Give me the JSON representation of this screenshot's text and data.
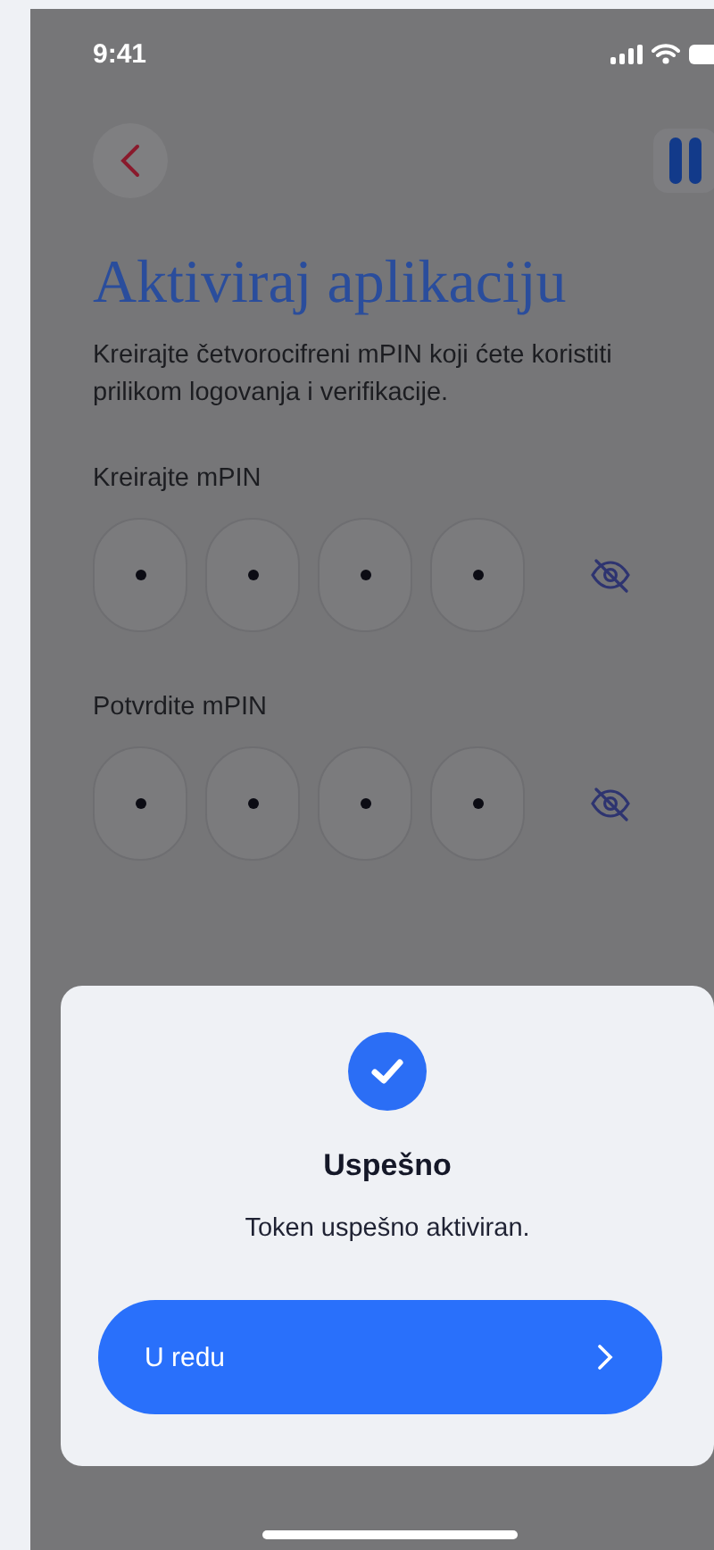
{
  "status_bar": {
    "time": "9:41"
  },
  "title": "Aktiviraj aplikaciju",
  "description": "Kreirajte četvorocifreni mPIN koji ćete koristiti prilikom logovanja i verifikacije.",
  "pin_groups": [
    {
      "label": "Kreirajte mPIN",
      "digits": [
        {
          "filled": true
        },
        {
          "filled": true
        },
        {
          "filled": true
        },
        {
          "filled": true
        }
      ]
    },
    {
      "label": "Potvrdite mPIN",
      "digits": [
        {
          "filled": true
        },
        {
          "filled": true
        },
        {
          "filled": true
        },
        {
          "filled": true
        }
      ]
    }
  ],
  "dialog": {
    "title": "Uspešno",
    "message": "Token uspešno aktiviran.",
    "button": "U redu"
  }
}
